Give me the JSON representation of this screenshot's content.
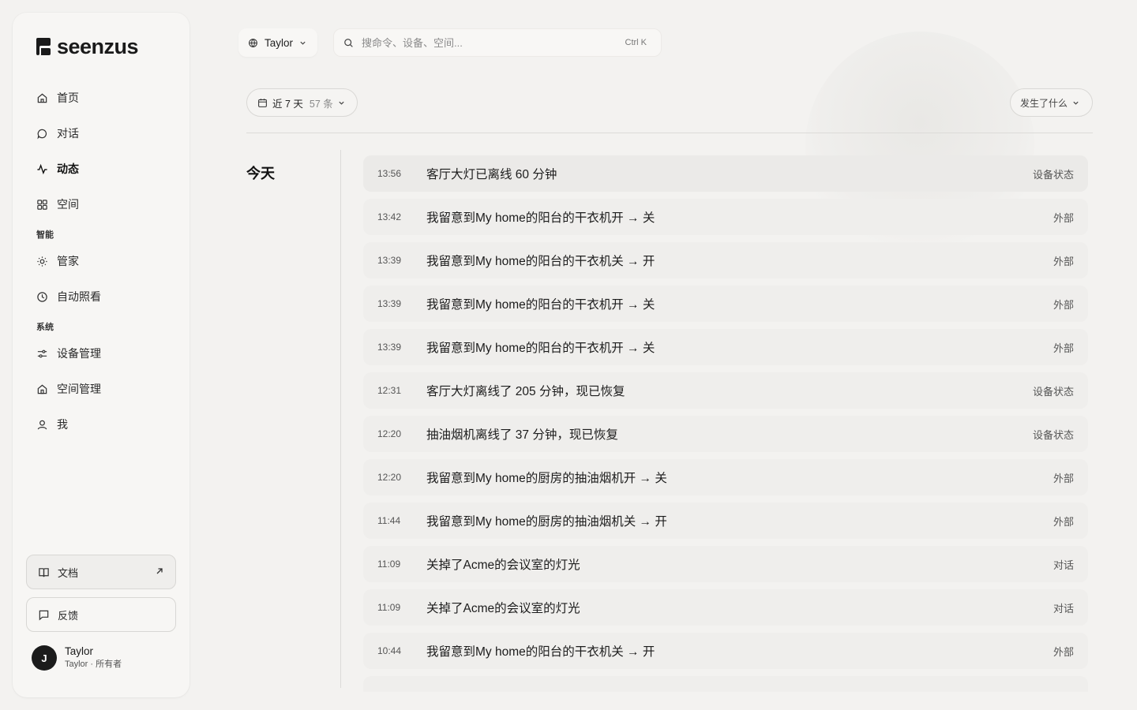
{
  "brand": {
    "name": "seenzus"
  },
  "nav": {
    "items": [
      {
        "label": "首页",
        "icon": "home-icon"
      },
      {
        "label": "对话",
        "icon": "chat-icon"
      },
      {
        "label": "动态",
        "icon": "activity-icon"
      },
      {
        "label": "空间",
        "icon": "grid-icon"
      }
    ],
    "section_smart": "智能",
    "smart_items": [
      {
        "label": "管家",
        "icon": "sun-icon"
      },
      {
        "label": "自动照看",
        "icon": "clock-icon"
      }
    ],
    "section_system": "系统",
    "system_items": [
      {
        "label": "设备管理",
        "icon": "sliders-icon"
      },
      {
        "label": "空间管理",
        "icon": "house-icon"
      },
      {
        "label": "我",
        "icon": "user-icon"
      }
    ]
  },
  "sidebar_footer": {
    "docs_label": "文档",
    "feedback_label": "反馈",
    "user_initial": "J",
    "user_name": "Taylor",
    "user_role": "Taylor · 所有者"
  },
  "topbar": {
    "space_label": "Taylor",
    "search_placeholder": "搜命令、设备、空间...",
    "shortcut": "Ctrl K"
  },
  "filters": {
    "range_label": "近 7 天",
    "range_count": "57 条",
    "what_label": "发生了什么"
  },
  "timeline": {
    "day_label": "今天",
    "events": [
      {
        "time": "13:56",
        "text": "客厅大灯已离线 60 分钟",
        "tag": "设备状态"
      },
      {
        "time": "13:42",
        "text": "我留意到My home的阳台的干衣机开 → 关",
        "tag": "外部"
      },
      {
        "time": "13:39",
        "text": "我留意到My home的阳台的干衣机关 → 开",
        "tag": "外部"
      },
      {
        "time": "13:39",
        "text": "我留意到My home的阳台的干衣机开 → 关",
        "tag": "外部"
      },
      {
        "time": "13:39",
        "text": "我留意到My home的阳台的干衣机开 → 关",
        "tag": "外部"
      },
      {
        "time": "12:31",
        "text": "客厅大灯离线了 205 分钟，现已恢复",
        "tag": "设备状态"
      },
      {
        "time": "12:20",
        "text": "抽油烟机离线了 37 分钟，现已恢复",
        "tag": "设备状态"
      },
      {
        "time": "12:20",
        "text": "我留意到My home的厨房的抽油烟机开 → 关",
        "tag": "外部"
      },
      {
        "time": "11:44",
        "text": "我留意到My home的厨房的抽油烟机关 → 开",
        "tag": "外部"
      },
      {
        "time": "11:09",
        "text": "关掉了Acme的会议室的灯光",
        "tag": "对话"
      },
      {
        "time": "11:09",
        "text": "关掉了Acme的会议室的灯光",
        "tag": "对话"
      },
      {
        "time": "10:44",
        "text": "我留意到My home的阳台的干衣机关 → 开",
        "tag": "外部"
      }
    ]
  }
}
